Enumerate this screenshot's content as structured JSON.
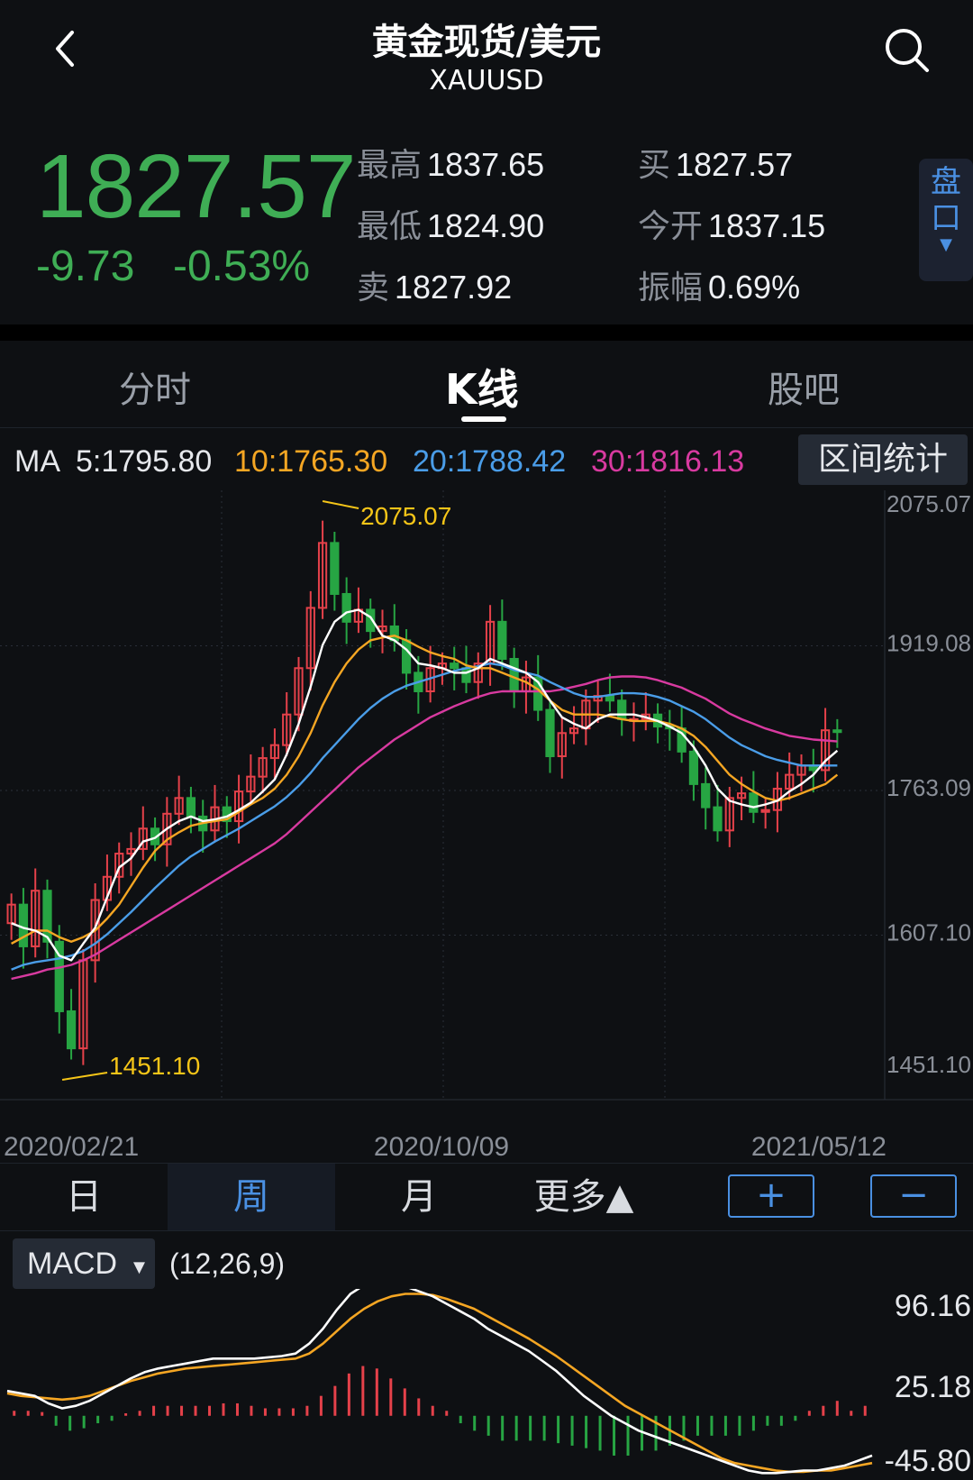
{
  "header": {
    "title": "黄金现货/美元",
    "symbol": "XAUUSD",
    "back_icon": "chevron-left-icon",
    "search_icon": "search-icon"
  },
  "quote": {
    "price": "1827.57",
    "change": "-9.73",
    "change_pct": "-0.53%",
    "high_label": "最高",
    "high": "1837.65",
    "low_label": "最低",
    "low": "1824.90",
    "sell_label": "卖",
    "sell": "1827.92",
    "buy_label": "买",
    "buy": "1827.57",
    "open_label": "今开",
    "open": "1837.15",
    "amp_label": "振幅",
    "amp": "0.69%",
    "pankou_line1": "盘",
    "pankou_line2": "口",
    "pankou_arrow": "▼"
  },
  "tabs": [
    {
      "label": "分时",
      "active": false
    },
    {
      "label": "K线",
      "active": true
    },
    {
      "label": "股吧",
      "active": false
    }
  ],
  "ma": {
    "prefix": "MA",
    "ma5": "5:1795.80",
    "ma10": "10:1765.30",
    "ma20": "20:1788.42",
    "ma30": "30:1816.13",
    "range_button": "区间统计"
  },
  "chart_data": {
    "type": "candlestick",
    "y_ticks": [
      "2075.07",
      "1919.08",
      "1763.09",
      "1607.10",
      "1451.10"
    ],
    "y_range": [
      1451.1,
      2075.07
    ],
    "x_ticks": [
      "2020/02/21",
      "2020/10/09",
      "2021/05/12"
    ],
    "max_label": "2075.07",
    "min_label": "1451.10",
    "colors": {
      "up": "#e5414a",
      "down": "#27a543",
      "ma5": "#ffffff",
      "ma10": "#f5a623",
      "ma20": "#4a9de8",
      "ma30": "#d83aa0"
    },
    "closes": [
      1640,
      1595,
      1655,
      1600,
      1525,
      1485,
      1580,
      1645,
      1670,
      1695,
      1700,
      1722,
      1705,
      1738,
      1755,
      1735,
      1720,
      1745,
      1730,
      1762,
      1778,
      1798,
      1812,
      1845,
      1895,
      1960,
      2030,
      1975,
      1945,
      1958,
      1935,
      1940,
      1925,
      1890,
      1870,
      1895,
      1900,
      1895,
      1880,
      1900,
      1945,
      1905,
      1870,
      1885,
      1850,
      1800,
      1825,
      1830,
      1860,
      1865,
      1860,
      1840,
      1840,
      1845,
      1832,
      1830,
      1805,
      1770,
      1745,
      1720,
      1755,
      1760,
      1740,
      1742,
      1765,
      1780,
      1790,
      1785,
      1828,
      1827
    ],
    "ma5": [
      1620,
      1615,
      1612,
      1605,
      1585,
      1580,
      1598,
      1615,
      1648,
      1680,
      1690,
      1708,
      1712,
      1722,
      1730,
      1735,
      1730,
      1732,
      1735,
      1742,
      1750,
      1762,
      1775,
      1802,
      1835,
      1875,
      1920,
      1945,
      1955,
      1958,
      1950,
      1930,
      1925,
      1915,
      1900,
      1898,
      1895,
      1890,
      1890,
      1895,
      1905,
      1900,
      1895,
      1890,
      1880,
      1860,
      1842,
      1835,
      1830,
      1840,
      1845,
      1845,
      1845,
      1842,
      1838,
      1832,
      1825,
      1810,
      1790,
      1765,
      1752,
      1748,
      1745,
      1748,
      1752,
      1762,
      1770,
      1780,
      1795,
      1806
    ],
    "ma10": [
      1598,
      1605,
      1612,
      1612,
      1605,
      1600,
      1605,
      1612,
      1625,
      1640,
      1660,
      1680,
      1698,
      1710,
      1718,
      1725,
      1728,
      1730,
      1732,
      1740,
      1748,
      1755,
      1765,
      1780,
      1800,
      1825,
      1855,
      1880,
      1900,
      1915,
      1925,
      1928,
      1930,
      1925,
      1918,
      1912,
      1908,
      1905,
      1898,
      1895,
      1895,
      1890,
      1885,
      1880,
      1872,
      1860,
      1850,
      1845,
      1845,
      1845,
      1843,
      1840,
      1838,
      1838,
      1838,
      1835,
      1830,
      1822,
      1810,
      1795,
      1780,
      1770,
      1762,
      1755,
      1752,
      1755,
      1760,
      1765,
      1770,
      1780
    ],
    "ma20": [
      1570,
      1575,
      1578,
      1580,
      1582,
      1585,
      1590,
      1598,
      1608,
      1620,
      1632,
      1645,
      1658,
      1670,
      1682,
      1692,
      1700,
      1708,
      1715,
      1722,
      1730,
      1738,
      1746,
      1756,
      1768,
      1782,
      1798,
      1812,
      1826,
      1840,
      1852,
      1862,
      1870,
      1876,
      1880,
      1884,
      1888,
      1892,
      1895,
      1897,
      1900,
      1898,
      1893,
      1890,
      1887,
      1880,
      1874,
      1868,
      1864,
      1864,
      1866,
      1868,
      1868,
      1867,
      1864,
      1860,
      1854,
      1848,
      1840,
      1830,
      1820,
      1812,
      1806,
      1800,
      1796,
      1793,
      1790,
      1790,
      1790,
      1790
    ],
    "ma30": [
      1560,
      1563,
      1566,
      1570,
      1572,
      1575,
      1580,
      1586,
      1594,
      1602,
      1610,
      1618,
      1626,
      1634,
      1642,
      1650,
      1658,
      1666,
      1674,
      1682,
      1690,
      1698,
      1706,
      1716,
      1728,
      1740,
      1752,
      1764,
      1776,
      1788,
      1798,
      1808,
      1818,
      1826,
      1834,
      1842,
      1848,
      1854,
      1859,
      1864,
      1868,
      1870,
      1870,
      1870,
      1870,
      1870,
      1872,
      1875,
      1878,
      1882,
      1885,
      1886,
      1886,
      1885,
      1882,
      1878,
      1874,
      1868,
      1862,
      1854,
      1846,
      1840,
      1835,
      1830,
      1826,
      1822,
      1820,
      1818,
      1817,
      1816
    ]
  },
  "periods": {
    "day": "日",
    "week": "周",
    "month": "月",
    "more": "更多▲",
    "zoom_in": "+",
    "zoom_out": "−"
  },
  "macd": {
    "indicator": "MACD",
    "selector_arrow": "▼",
    "params": "(12,26,9)",
    "y_ticks": [
      "96.16",
      "25.18",
      "-45.80"
    ],
    "y_range": [
      -45.8,
      96.16
    ],
    "dif": [
      20,
      18,
      16,
      10,
      6,
      8,
      12,
      18,
      24,
      30,
      35,
      38,
      40,
      42,
      44,
      46,
      46,
      46,
      46,
      47,
      48,
      50,
      58,
      70,
      85,
      98,
      105,
      106,
      106,
      104,
      100,
      96,
      90,
      84,
      78,
      70,
      64,
      58,
      52,
      44,
      36,
      26,
      16,
      8,
      0,
      -6,
      -12,
      -16,
      -20,
      -24,
      -28,
      -32,
      -36,
      -40,
      -44,
      -46,
      -46,
      -45,
      -44,
      -44,
      -42,
      -40,
      -36,
      -32
    ],
    "dea": [
      18,
      16,
      15,
      14,
      13,
      14,
      16,
      20,
      24,
      28,
      31,
      34,
      36,
      38,
      39,
      40,
      41,
      42,
      43,
      44,
      45,
      46,
      50,
      58,
      68,
      78,
      86,
      92,
      96,
      98,
      98,
      97,
      94,
      90,
      86,
      80,
      74,
      68,
      62,
      55,
      48,
      40,
      32,
      24,
      16,
      8,
      2,
      -4,
      -10,
      -16,
      -22,
      -28,
      -34,
      -38,
      -40,
      -42,
      -44,
      -45,
      -45,
      -44,
      -44,
      -42,
      -40,
      -38
    ],
    "hist": [
      4,
      4,
      3,
      -8,
      -12,
      -10,
      -6,
      -4,
      2,
      4,
      8,
      8,
      8,
      8,
      8,
      10,
      10,
      8,
      6,
      6,
      6,
      8,
      16,
      24,
      34,
      40,
      38,
      30,
      22,
      14,
      8,
      4,
      -6,
      -12,
      -16,
      -20,
      -20,
      -20,
      -20,
      -22,
      -24,
      -26,
      -28,
      -32,
      -32,
      -28,
      -28,
      -24,
      -20,
      -16,
      -16,
      -16,
      -16,
      -12,
      -8,
      -8,
      -4,
      4,
      8,
      12,
      4,
      8
    ]
  }
}
